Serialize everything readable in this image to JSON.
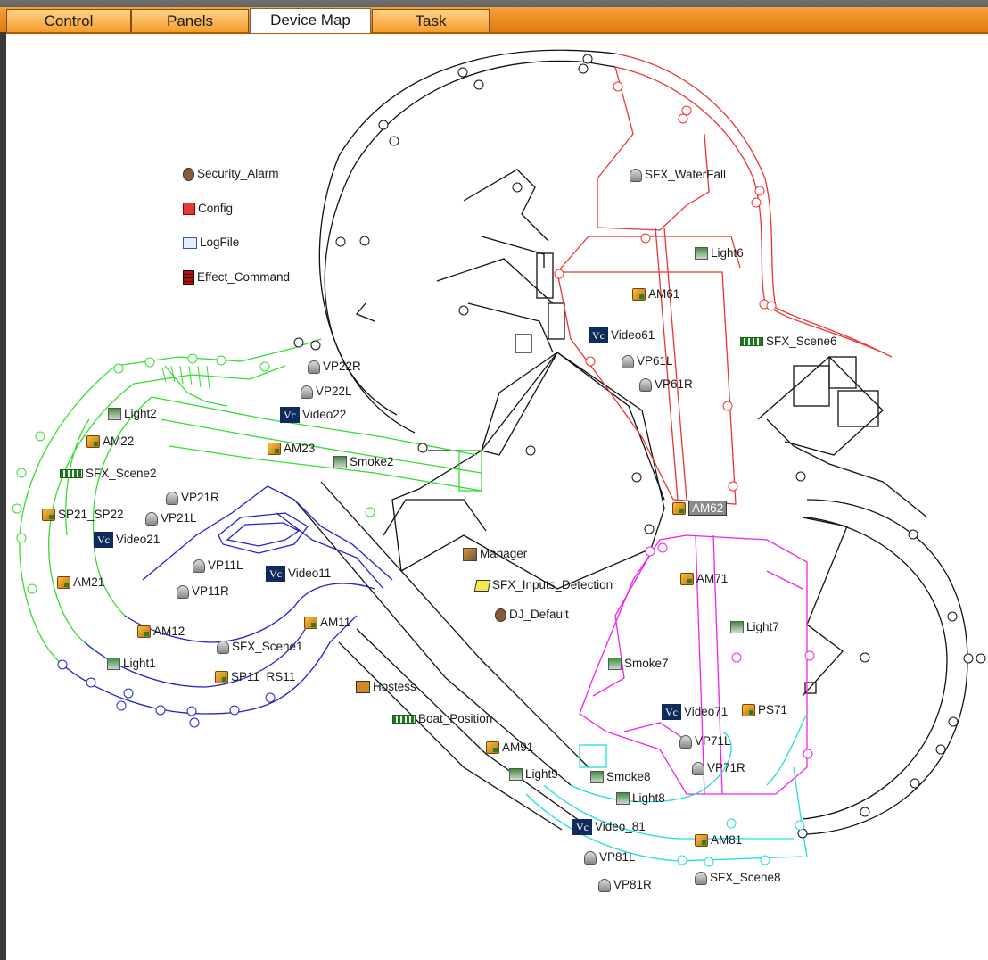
{
  "tabs": [
    {
      "label": "Control",
      "active": false
    },
    {
      "label": "Panels",
      "active": false
    },
    {
      "label": "Device Map",
      "active": true
    },
    {
      "label": "Task",
      "active": false
    }
  ],
  "legend": {
    "security_alarm": "Security_Alarm",
    "config": "Config",
    "logfile": "LogFile",
    "effect_command": "Effect_Command"
  },
  "devices": {
    "sfx_waterfall": "SFX_WaterFall",
    "light6": "Light6",
    "am61": "AM61",
    "video61": "Video61",
    "sfx_scene6": "SFX_Scene6",
    "vp61l": "VP61L",
    "vp61r": "VP61R",
    "vp22r": "VP22R",
    "vp22l": "VP22L",
    "video22": "Video22",
    "light2": "Light2",
    "am22": "AM22",
    "am23": "AM23",
    "smoke2": "Smoke2",
    "sfx_scene2": "SFX_Scene2",
    "vp21r": "VP21R",
    "vp21l": "VP21L",
    "sp21_sp22": "SP21_SP22",
    "video21": "Video21",
    "vp11l": "VP11L",
    "vp11r": "VP11R",
    "video11": "Video11",
    "am21": "AM21",
    "am12": "AM12",
    "sfx_scene1": "SFX_Scene1",
    "am11": "AM11",
    "light1": "Light1",
    "sp11_rs11": "SP11_RS11",
    "am62": "AM62",
    "manager": "Manager",
    "sfx_inputs_detection": "SFX_Inputs_Detection",
    "dj_default": "DJ_Default",
    "am71": "AM71",
    "light7": "Light7",
    "smoke7": "Smoke7",
    "hostess": "Hostess",
    "boat_position": "Boat_Position",
    "video71": "Video71",
    "ps71": "PS71",
    "vp71l": "VP71L",
    "vp71r": "VP71R",
    "am91": "AM91",
    "light9": "Light9",
    "smoke8": "Smoke8",
    "light8": "Light8",
    "video_81": "Video_81",
    "am81": "AM81",
    "vp81l": "VP81L",
    "vp81r": "VP81R",
    "sfx_scene8": "SFX_Scene8"
  },
  "icon_text": {
    "video": "Vc"
  },
  "colors": {
    "zone_red": "#ee3333",
    "zone_green": "#33dd33",
    "zone_blue": "#2222cc",
    "zone_magenta": "#ee22ee",
    "zone_cyan": "#22dddd",
    "walls": "#111111",
    "tab_orange": "#f08c1e"
  }
}
